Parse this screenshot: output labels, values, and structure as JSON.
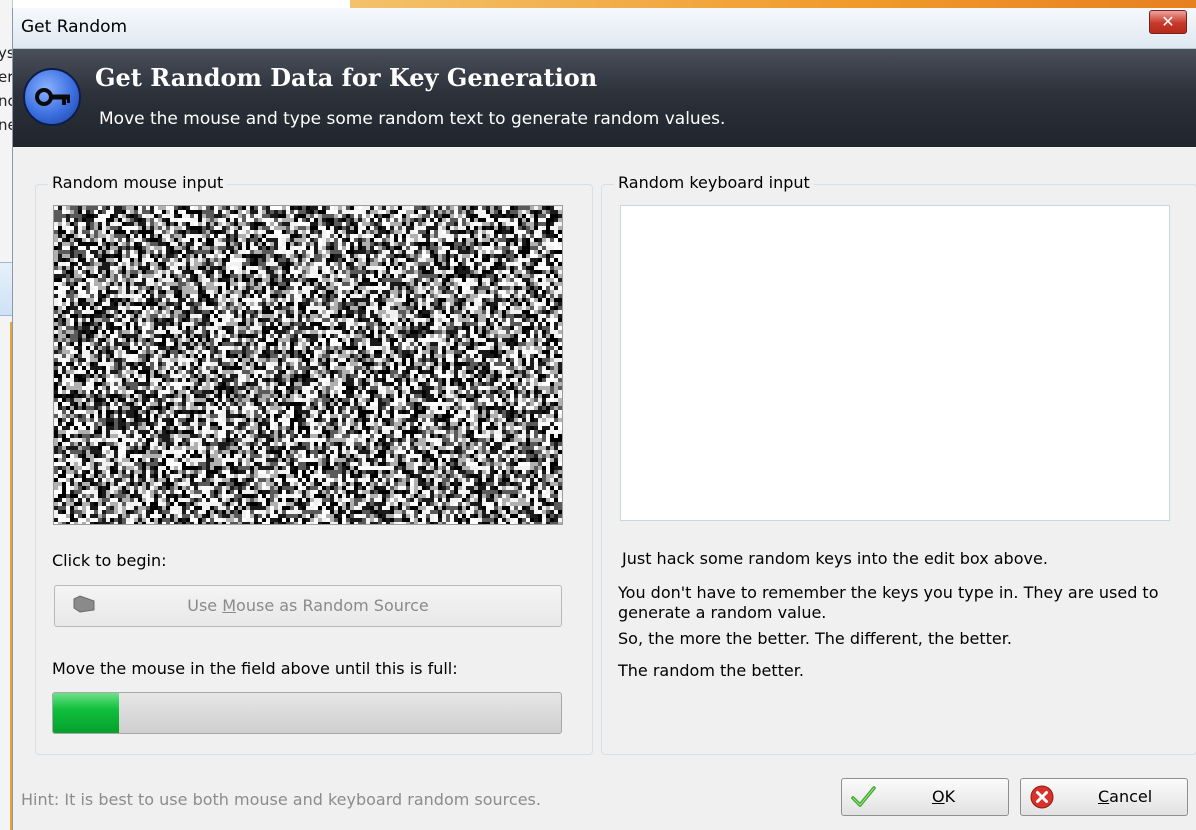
{
  "background": {
    "left_fragments": [
      "ys",
      "er",
      "nc",
      "ne"
    ]
  },
  "window": {
    "title": "Get Random",
    "close_glyph": "✕"
  },
  "header": {
    "title": "Get Random Data for Key Generation",
    "subtitle": "Move the mouse and type some random text to generate random values.",
    "icon": "key-icon"
  },
  "mouse_panel": {
    "legend": "Random mouse input",
    "click_label": "Click to begin:",
    "source_button_prefix": "Use ",
    "source_button_mnemonic": "M",
    "source_button_suffix": "ouse as Random Source",
    "source_button_icon": "tag-icon",
    "progress_label": "Move the mouse in the field above until this is full:",
    "progress_fraction": 0.13
  },
  "keyboard_panel": {
    "legend": "Random keyboard input",
    "input_value": "",
    "line1": "Just hack some random keys into the edit box above.",
    "line2": "You don't have to remember the keys you type in. They are used to generate a random value.",
    "line3": "So, the more the better. The different, the better.",
    "line4": "The random the better."
  },
  "footer": {
    "hint": "Hint: It is best to use both mouse and keyboard random sources.",
    "ok_mnemonic": "O",
    "ok_rest": "K",
    "cancel_mnemonic": "C",
    "cancel_rest": "ancel",
    "ok_icon": "checkmark-icon",
    "cancel_icon": "cancel-icon"
  },
  "colors": {
    "progress_fill": "#10c03c",
    "header_bg": "#2c313a",
    "close_button": "#c8392a"
  }
}
